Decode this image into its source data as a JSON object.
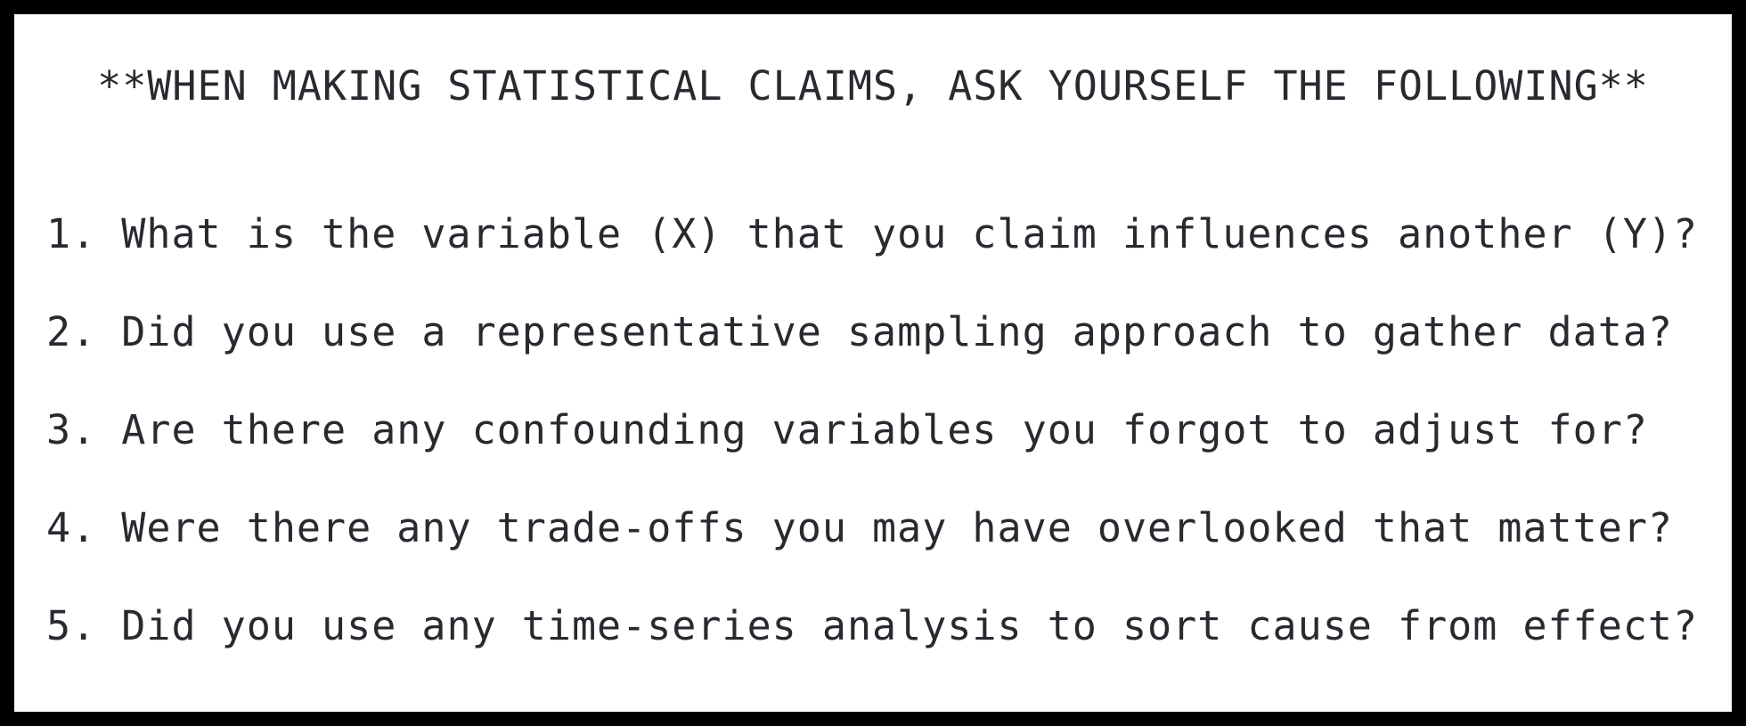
{
  "heading": "**WHEN MAKING STATISTICAL CLAIMS, ASK YOURSELF THE FOLLOWING**",
  "items": [
    "1. What is the variable (X) that you claim influences another (Y)?",
    "2. Did you use a representative sampling approach to gather data?",
    "3. Are there any confounding variables you forgot to adjust for?",
    "4. Were there any trade-offs you may have overlooked that matter?",
    "5. Did you use any time-series analysis to sort cause from effect?"
  ],
  "colors": {
    "border": "#000000",
    "text": "#2b2830",
    "background": "#ffffff"
  }
}
